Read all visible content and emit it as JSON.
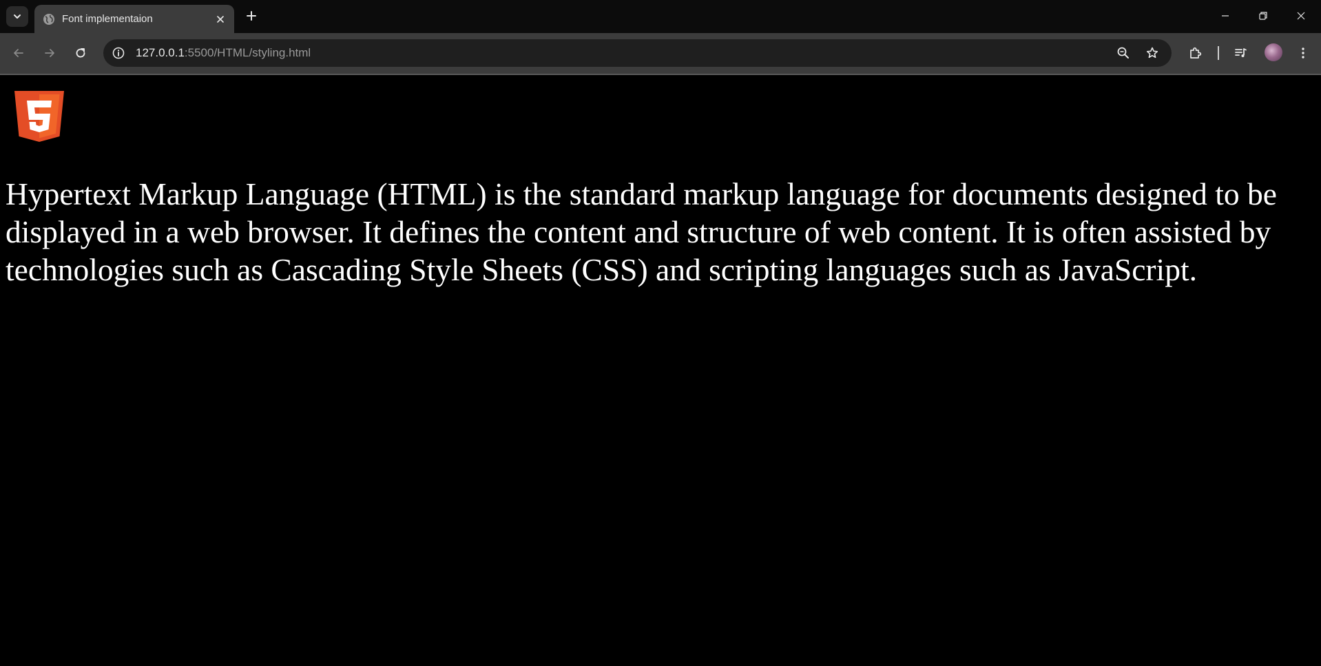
{
  "browser": {
    "tab": {
      "title": "Font implementaion"
    },
    "omnibox": {
      "url_host": "127.0.0.1",
      "url_rest": ":5500/HTML/styling.html"
    }
  },
  "page": {
    "logo_text": "5",
    "paragraph": "Hypertext Markup Language (HTML) is the standard markup language for documents designed to be displayed in a web browser. It defines the content and structure of web content. It is often assisted by technologies such as Cascading Style Sheets (CSS) and scripting languages such as JavaScript."
  },
  "colors": {
    "tabstrip_bg": "#0c0c0c",
    "toolbar_bg": "#3c3c3c",
    "omnibox_bg": "#1f1f1f",
    "page_bg": "#000000",
    "text": "#ffffff",
    "html5_orange": "#e44d26",
    "html5_orange_light": "#f16529"
  },
  "icons": {
    "tab_search": "chevron-down-icon",
    "favicon": "globe-icon",
    "tab_close": "close-icon",
    "new_tab": "plus-icon",
    "minimize": "minimize-icon",
    "maximize": "restore-icon",
    "window_close": "close-icon",
    "back": "arrow-left-icon",
    "forward": "arrow-right-icon",
    "reload": "reload-icon",
    "site_info": "info-icon",
    "zoom": "zoom-out-icon",
    "bookmark": "star-icon",
    "extensions": "puzzle-icon",
    "media": "media-controls-icon",
    "menu": "kebab-menu-icon"
  }
}
